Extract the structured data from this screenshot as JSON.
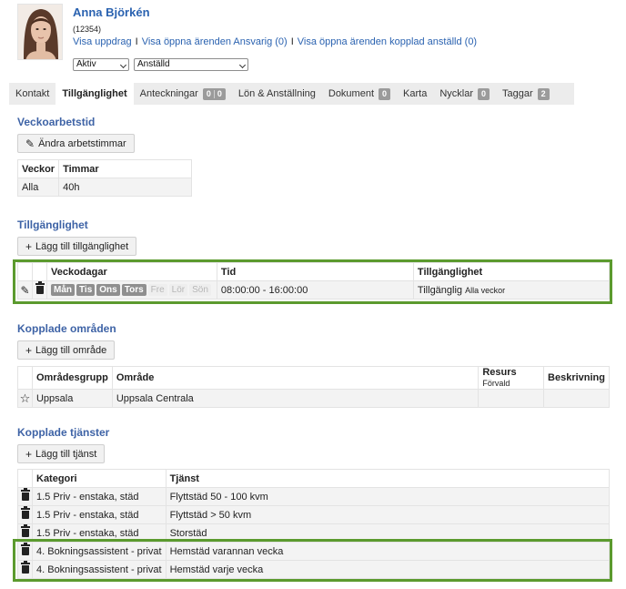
{
  "employee": {
    "name": "Anna Björkén",
    "id": "(12354)",
    "links": [
      "Visa uppdrag",
      "Visa öppna ärenden Ansvarig (0)",
      "Visa öppna ärenden kopplad anställd (0)"
    ],
    "status": "Aktiv",
    "role": "Anställd"
  },
  "tabs": [
    {
      "label": "Kontakt"
    },
    {
      "label": "Tillgänglighet",
      "active": true
    },
    {
      "label": "Anteckningar",
      "badge": [
        "0",
        "0"
      ]
    },
    {
      "label": "Lön & Anställning"
    },
    {
      "label": "Dokument",
      "badge": [
        "0"
      ]
    },
    {
      "label": "Karta"
    },
    {
      "label": "Nycklar",
      "badge": [
        "0"
      ]
    },
    {
      "label": "Taggar",
      "badge": [
        "2"
      ]
    }
  ],
  "veckoarbetstid": {
    "title": "Veckoarbetstid",
    "button": "Ändra arbetstimmar",
    "headers": [
      "Veckor",
      "Timmar"
    ],
    "rows": [
      [
        "Alla",
        "40h"
      ]
    ]
  },
  "tillganglighet": {
    "title": "Tillgänglighet",
    "button": "Lägg till tillgänglighet",
    "headers": [
      "Veckodagar",
      "Tid",
      "Tillgänglighet"
    ],
    "row": {
      "days": [
        {
          "label": "Mån",
          "on": true
        },
        {
          "label": "Tis",
          "on": true
        },
        {
          "label": "Ons",
          "on": true
        },
        {
          "label": "Tors",
          "on": true
        },
        {
          "label": "Fre",
          "on": false
        },
        {
          "label": "Lör",
          "on": false
        },
        {
          "label": "Sön",
          "on": false
        }
      ],
      "time": "08:00:00 - 16:00:00",
      "availability": "Tillgänglig",
      "availability_note": "Alla veckor"
    }
  },
  "omraden": {
    "title": "Kopplade områden",
    "button": "Lägg till område",
    "headers": [
      "Områdesgrupp",
      "Område",
      "Resurs",
      "Förvald",
      "Beskrivning"
    ],
    "rows": [
      [
        "Uppsala",
        "Uppsala Centrala",
        "",
        ""
      ]
    ]
  },
  "tjanster": {
    "title": "Kopplade tjänster",
    "button": "Lägg till tjänst",
    "headers": [
      "Kategori",
      "Tjänst"
    ],
    "rows": [
      [
        "1.5 Priv - enstaka, städ",
        "Flyttstäd 50 - 100 kvm"
      ],
      [
        "1.5 Priv - enstaka, städ",
        "Flyttstäd > 50 kvm"
      ],
      [
        "1.5 Priv - enstaka, städ",
        "Storstäd"
      ],
      [
        "4. Bokningsassistent - privat",
        "Hemstäd varannan vecka"
      ],
      [
        "4. Bokningsassistent - privat",
        "Hemstäd varje vecka"
      ]
    ]
  },
  "colors": {
    "link": "#2a62b0",
    "section_title": "#3e63a6",
    "highlight": "#5b9a2e",
    "badge": "#9b9b9b"
  }
}
